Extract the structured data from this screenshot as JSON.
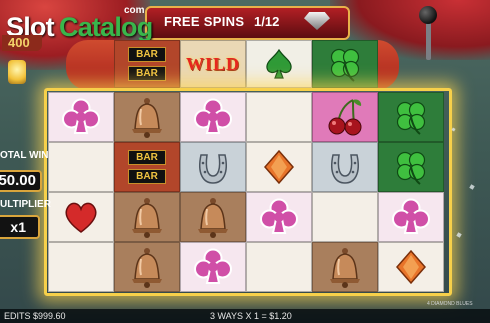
{
  "brand": {
    "name_part1": "Slot",
    "name_part2": "Catalog",
    "domain_suffix": "com",
    "game_badge": "400"
  },
  "header": {
    "free_spins_label": "FREE SPINS",
    "free_spins_count": "1/12",
    "gem_icon": "diamond-icon"
  },
  "top_row": [
    {
      "symbol": "double-bar",
      "texts": [
        "BAR",
        "BAR"
      ]
    },
    {
      "symbol": "wild",
      "text": "WILD"
    },
    {
      "symbol": "spade"
    },
    {
      "symbol": "clover"
    }
  ],
  "reels": [
    [
      "club",
      "blank",
      "heart",
      "blank"
    ],
    [
      "bell",
      "double-bar",
      "bell",
      "bell"
    ],
    [
      "club",
      "horseshoe",
      "bell",
      "club"
    ],
    [
      "blank",
      "diamond",
      "club",
      "blank"
    ],
    [
      "cherry",
      "horseshoe",
      "blank",
      "bell"
    ],
    [
      "clover",
      "clover",
      "club",
      "diamond"
    ]
  ],
  "bar_text": "BAR",
  "left_panel": {
    "total_win_label": "OTAL WIN",
    "total_win_value": "50.00",
    "multiplier_label": "ULTIPLIER",
    "multiplier_value": "x1"
  },
  "footer": {
    "balance": "EDITS $999.60",
    "ways_win": "3 WAYS X 1 = $1.20",
    "game_title": "4 DIAMOND BLUES"
  },
  "colors": {
    "frame_gold": "#f7d04a",
    "bezel_red": "#b21f24",
    "logo_green": "#39b64b"
  }
}
